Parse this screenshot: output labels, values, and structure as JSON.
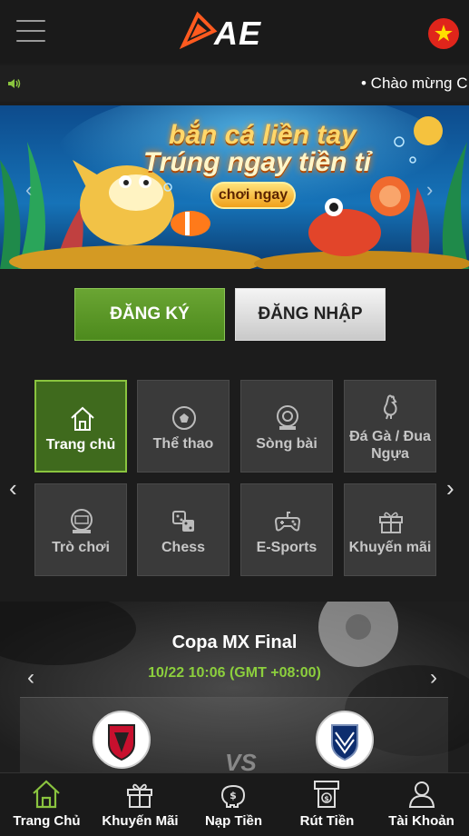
{
  "header": {
    "logo_text": "AE"
  },
  "marquee": {
    "text": "• Chào mừng C"
  },
  "banner": {
    "line1": "bắn cá liền tay",
    "line2": "Trúng ngay tiền tỉ",
    "cta": "chơi ngay"
  },
  "auth": {
    "register_label": "ĐĂNG KÝ",
    "login_label": "ĐĂNG NHẬP"
  },
  "categories": [
    {
      "label": "Trang chủ",
      "icon": "home-icon"
    },
    {
      "label": "Thể thao",
      "icon": "soccer-ball-icon"
    },
    {
      "label": "Sòng bài",
      "icon": "casino-chip-icon"
    },
    {
      "label": "Đá Gà / Đua Ngựa",
      "icon": "rooster-icon"
    },
    {
      "label": "Trò chơi",
      "icon": "slot-machine-icon"
    },
    {
      "label": "Chess",
      "icon": "dice-icon"
    },
    {
      "label": "E-Sports",
      "icon": "gamepad-icon"
    },
    {
      "label": "Khuyến mãi",
      "icon": "gift-icon"
    }
  ],
  "match": {
    "title": "Copa MX Final",
    "time": "10/22 10:06 (GMT +08:00)",
    "vs": "VS"
  },
  "bottom_nav": [
    {
      "label": "Trang Chủ",
      "icon": "home-icon"
    },
    {
      "label": "Khuyến Mãi",
      "icon": "gift-icon"
    },
    {
      "label": "Nạp Tiền",
      "icon": "piggy-bank-icon"
    },
    {
      "label": "Rút Tiền",
      "icon": "atm-withdraw-icon"
    },
    {
      "label": "Tài Khoản",
      "icon": "user-icon"
    }
  ],
  "colors": {
    "accent_green": "#6aa533",
    "time_green": "#8ccf3d",
    "flag_red": "#e0251b"
  }
}
